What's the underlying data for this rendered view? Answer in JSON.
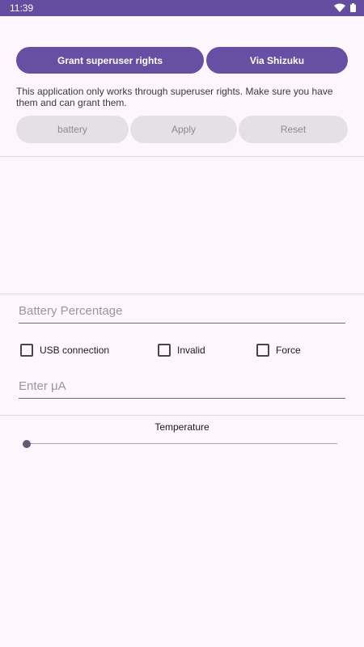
{
  "status_bar": {
    "time": "11:39",
    "icons": [
      "wifi-icon",
      "battery-icon"
    ],
    "color": "#644C9E"
  },
  "root_section": {
    "grant_button": "Grant superuser rights",
    "shizuku_button": "Via Shizuku",
    "info": "This application only works through superuser rights. Make sure you have them and can grant them.",
    "accent_color": "#6750A4"
  },
  "actions": {
    "battery_button": "battery",
    "apply_button": "Apply",
    "reset_button": "Reset"
  },
  "form": {
    "battery_percentage": {
      "value": "",
      "placeholder": "Battery Percentage"
    },
    "checkboxes": [
      {
        "label": "USB connection",
        "checked": false
      },
      {
        "label": "Invalid",
        "checked": false
      },
      {
        "label": "Force",
        "checked": false
      }
    ],
    "current": {
      "value": "",
      "placeholder": "Enter μA"
    }
  },
  "temperature": {
    "label": "Temperature",
    "value": 0
  }
}
